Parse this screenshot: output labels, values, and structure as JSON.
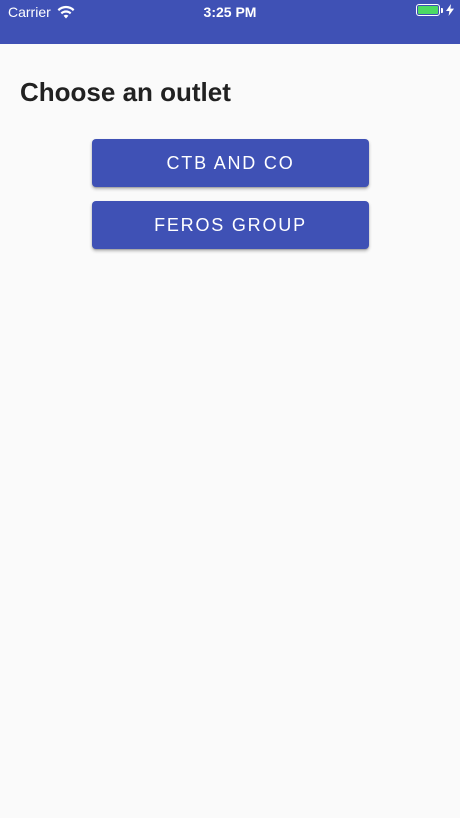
{
  "status_bar": {
    "carrier": "Carrier",
    "time": "3:25 PM",
    "icons": [
      "wifi-icon",
      "battery-icon",
      "charging-bolt-icon"
    ],
    "battery_level": 1.0
  },
  "page": {
    "title": "Choose an outlet"
  },
  "outlets": [
    {
      "label": "CTB AND CO"
    },
    {
      "label": "FEROS GROUP"
    }
  ],
  "colors": {
    "primary": "#3f51b5",
    "background": "#fafafa",
    "title_text": "#212121",
    "battery": "#4cd964"
  }
}
